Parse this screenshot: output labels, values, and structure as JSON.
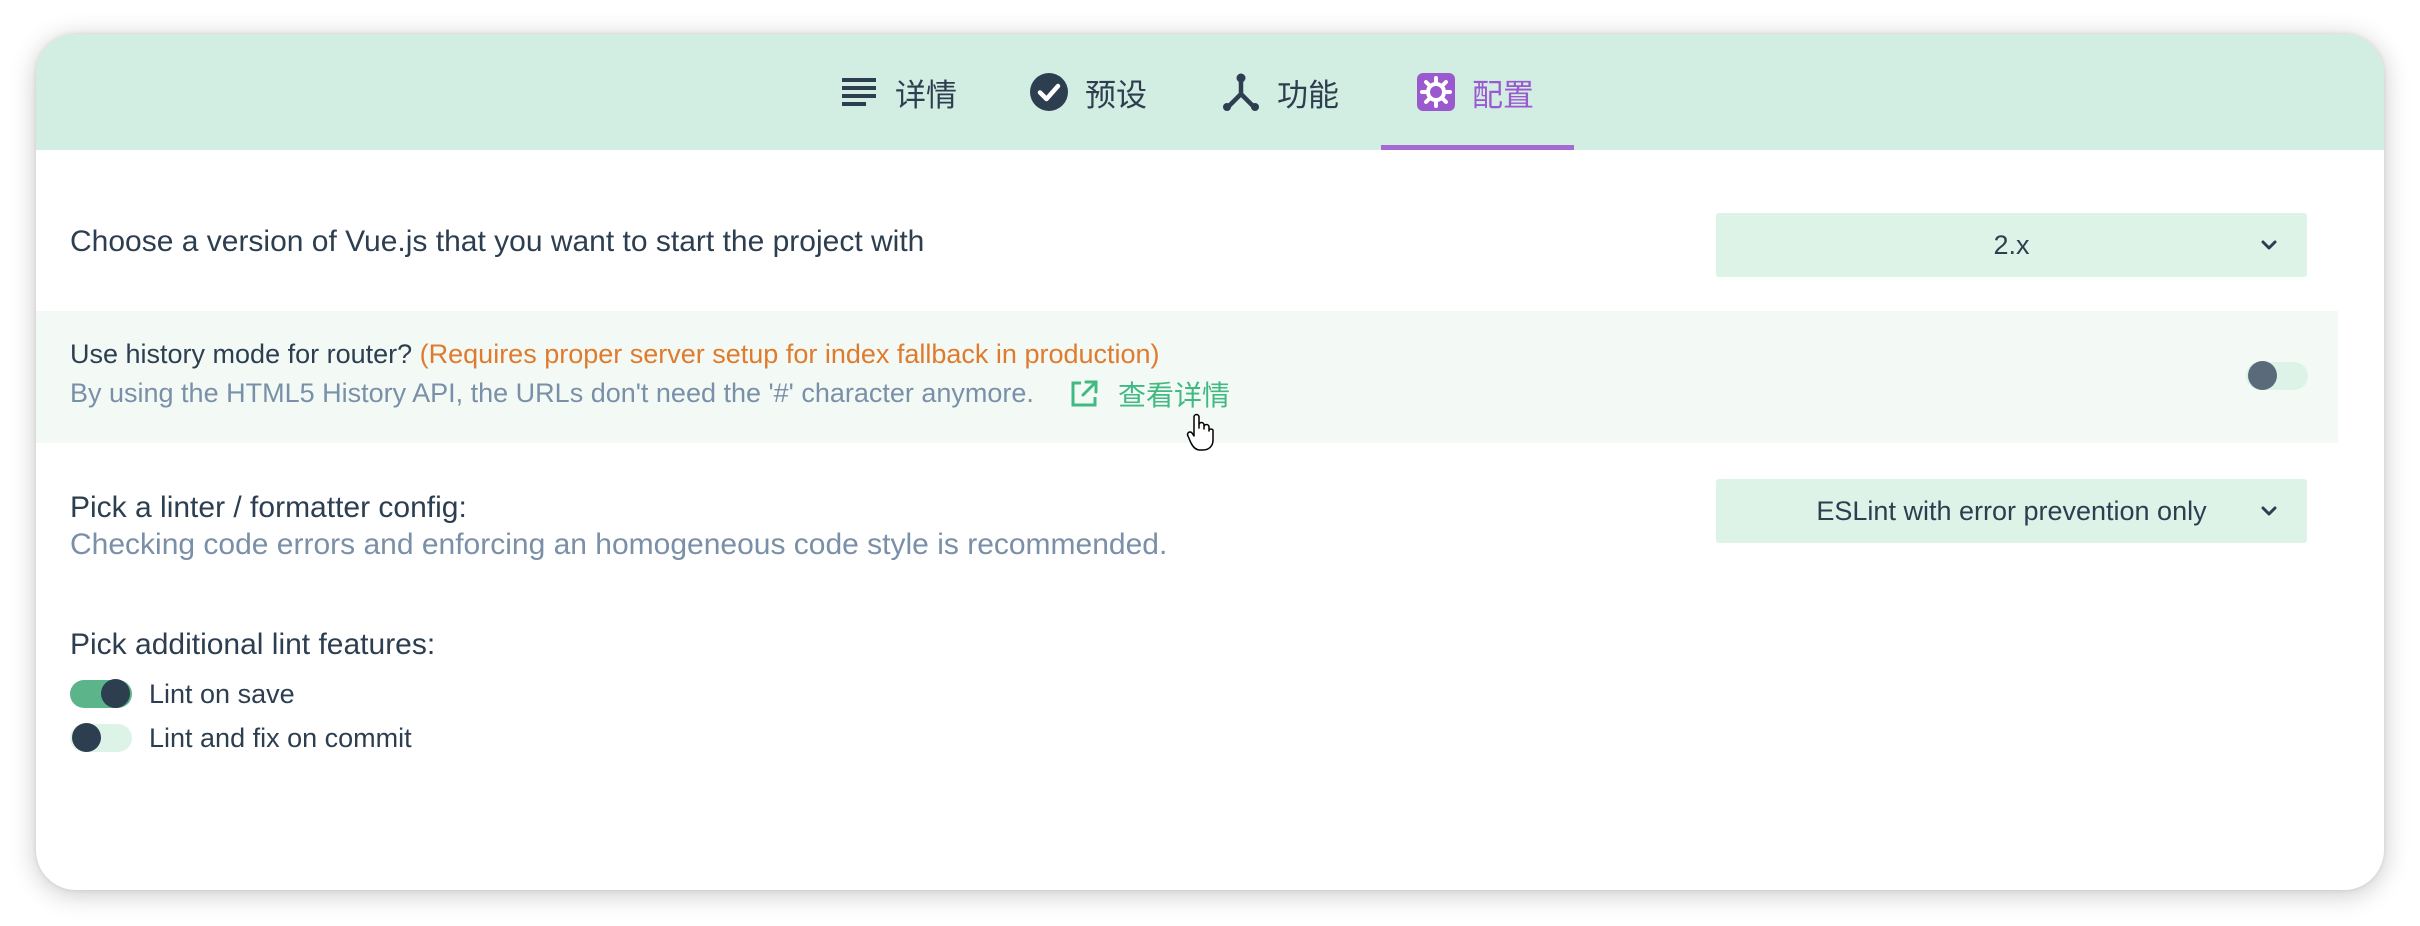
{
  "tabs": [
    {
      "label": "详情",
      "icon": "list-icon",
      "active": false
    },
    {
      "label": "预设",
      "icon": "check-circle-icon",
      "active": false
    },
    {
      "label": "功能",
      "icon": "fork-icon",
      "active": false
    },
    {
      "label": "配置",
      "icon": "gear-icon",
      "active": true
    }
  ],
  "vue_version": {
    "label": "Choose a version of Vue.js that you want to start the project with",
    "value": "2.x"
  },
  "history_mode": {
    "label": "Use history mode for router?",
    "warning": "(Requires proper server setup for index fallback in production)",
    "description": "By using the HTML5 History API, the URLs don't need the '#' character anymore.",
    "link_label": "查看详情",
    "enabled": false
  },
  "linter": {
    "label": "Pick a linter / formatter config:",
    "description": "Checking code errors and enforcing an homogeneous code style is recommended.",
    "value": "ESLint with error prevention only"
  },
  "lint_features": {
    "label": "Pick additional lint features:",
    "options": [
      {
        "label": "Lint on save",
        "checked": true
      },
      {
        "label": "Lint and fix on commit",
        "checked": false
      }
    ]
  },
  "colors": {
    "accent": "#42b983",
    "active_tab": "#9b59d0",
    "warning": "#e07b2d",
    "header_bg": "#d2ede2"
  }
}
